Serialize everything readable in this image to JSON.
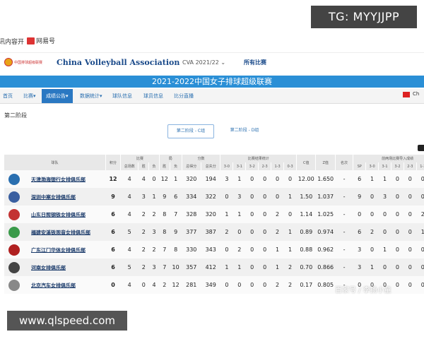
{
  "bookmarks": [
    {
      "label": "讯内容开"
    },
    {
      "label": "网易号"
    }
  ],
  "watermark_top": "TG: MYYJJPP",
  "watermark_bottom": "www.qlspeed.com",
  "watermark_right": "百家号 / 李扬小童",
  "header": {
    "org_name": "China Volleyball Association",
    "logo_text": "中国排球超级联赛",
    "season_select": "CVA 2021/22",
    "all_matches": "所有比赛"
  },
  "banner_title": "2021-2022中国女子排球超级联赛",
  "nav": [
    {
      "label": "首页"
    },
    {
      "label": "比赛"
    },
    {
      "label": "成绩公告"
    },
    {
      "label": "数据统计"
    },
    {
      "label": "球队信息"
    },
    {
      "label": "球员信息"
    },
    {
      "label": "比分直播"
    }
  ],
  "lang": "Ch",
  "stage_label": "第二阶段",
  "group_tabs": [
    "第二阶段 - C组",
    "第二阶段 - D组"
  ],
  "table": {
    "header_groups": [
      "球队",
      "积分",
      "比赛",
      "局",
      "分数",
      "比赛结果统计",
      "C值",
      "Z值",
      "名次",
      "前两场比赛导入成绩"
    ],
    "sub_headers": [
      "总场数",
      "胜",
      "负",
      "胜",
      "负",
      "总得分",
      "总失分",
      "3-0",
      "3-1",
      "3-2",
      "2-3",
      "1-3",
      "0-3",
      "SP",
      "3-0",
      "3-1",
      "3-2",
      "2-3",
      "1-3",
      "0-3"
    ],
    "rows": [
      {
        "team": "天津渤海银行女排俱乐部",
        "logo_color": "#2a6fb0",
        "cells": [
          "12",
          "4",
          "4",
          "0",
          "12",
          "1",
          "320",
          "194",
          "3",
          "1",
          "0",
          "0",
          "0",
          "0",
          "12.00",
          "1.650",
          "-",
          "6",
          "1",
          "1",
          "0",
          "0",
          "0",
          "0"
        ]
      },
      {
        "team": "深圳中塞女排俱乐部",
        "logo_color": "#3a5fa0",
        "cells": [
          "9",
          "4",
          "3",
          "1",
          "9",
          "6",
          "334",
          "322",
          "0",
          "3",
          "0",
          "0",
          "0",
          "1",
          "1.50",
          "1.037",
          "-",
          "9",
          "0",
          "3",
          "0",
          "0",
          "0",
          "0"
        ]
      },
      {
        "team": "山东日照钢铁女排俱乐部",
        "logo_color": "#c33333",
        "cells": [
          "6",
          "4",
          "2",
          "2",
          "8",
          "7",
          "328",
          "320",
          "1",
          "1",
          "0",
          "0",
          "2",
          "0",
          "1.14",
          "1.025",
          "-",
          "0",
          "0",
          "0",
          "0",
          "0",
          "2",
          "0"
        ]
      },
      {
        "team": "福建安溪铁观音女排俱乐部",
        "logo_color": "#3a9a4a",
        "cells": [
          "6",
          "5",
          "2",
          "3",
          "8",
          "9",
          "377",
          "387",
          "2",
          "0",
          "0",
          "0",
          "2",
          "1",
          "0.89",
          "0.974",
          "-",
          "6",
          "2",
          "0",
          "0",
          "0",
          "1",
          "0"
        ]
      },
      {
        "team": "广东江门华体女排俱乐部",
        "logo_color": "#b02020",
        "cells": [
          "6",
          "4",
          "2",
          "2",
          "7",
          "8",
          "330",
          "343",
          "0",
          "2",
          "0",
          "0",
          "1",
          "1",
          "0.88",
          "0.962",
          "-",
          "3",
          "0",
          "1",
          "0",
          "0",
          "0",
          "1"
        ]
      },
      {
        "team": "河南女排俱乐部",
        "logo_color": "#444444",
        "cells": [
          "6",
          "5",
          "2",
          "3",
          "7",
          "10",
          "357",
          "412",
          "1",
          "1",
          "0",
          "0",
          "1",
          "2",
          "0.70",
          "0.866",
          "-",
          "3",
          "1",
          "0",
          "0",
          "0",
          "0",
          "1"
        ]
      },
      {
        "team": "北京汽车女排俱乐部",
        "logo_color": "#888888",
        "cells": [
          "0",
          "4",
          "0",
          "4",
          "2",
          "12",
          "281",
          "349",
          "0",
          "0",
          "0",
          "0",
          "2",
          "2",
          "0.17",
          "0.805",
          "-",
          "0",
          "0",
          "0",
          "0",
          "0",
          "0",
          "2"
        ]
      }
    ]
  }
}
